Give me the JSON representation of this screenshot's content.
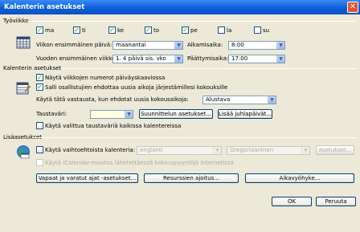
{
  "window": {
    "title": "Kalenterin asetukset",
    "close_glyph": "✕"
  },
  "workweek": {
    "section_label": "Työviikko",
    "days": [
      {
        "label": "ma",
        "checked": true
      },
      {
        "label": "ti",
        "checked": true
      },
      {
        "label": "ke",
        "checked": true
      },
      {
        "label": "to",
        "checked": true
      },
      {
        "label": "pe",
        "checked": true
      },
      {
        "label": "la",
        "checked": false
      },
      {
        "label": "su",
        "checked": false
      }
    ],
    "first_day_label": "Viikon ensimmäinen päivä:",
    "first_day_value": "maanantai",
    "first_week_label": "Vuoden ensimmäinen viikko:",
    "first_week_value": "1. 4 päivä sis. vko",
    "start_time_label": "Alkamisaika:",
    "start_time_value": "8:00",
    "end_time_label": "Päättymisaika:",
    "end_time_value": "17:00"
  },
  "calendar": {
    "section_label": "Kalenterin asetukset",
    "show_week_numbers": "Näytä viikkojen numerot päiväyskaaviossa",
    "allow_proposals": "Salli osallistujien ehdottaa uusia aikoja järjestämillesi kokouksille",
    "response_label": "Käytä tätä vastausta, kun ehdotat uusia kokousaikoja:",
    "response_value": "Alustava",
    "bg_color_label": "Taustaväri:",
    "scheduling_button": "Suunnittelun asetukset...",
    "holidays_button": "Lisää juhlapäivät...",
    "use_bg_all": "Käytä valittua taustaväriä kaikissa kalentereissa"
  },
  "advanced": {
    "section_label": "Lisäasetukset",
    "alt_calendar_label": "Käytä vaihtoehtoista kalenteria:",
    "alt_language": "englanti",
    "alt_type": "Gregoriaaninen",
    "alt_settings_button": "Asetukset...",
    "icalendar_label": "Käytä iCalendar-muotoa lähetettäessä kokouspyyntöjä Internetissä",
    "free_busy_button": "Vapaat ja varatut ajat -asetukset...",
    "resource_button": "Resurssien ajoitus...",
    "timezone_button": "Aikavyöhyke..."
  },
  "footer": {
    "ok": "OK",
    "cancel": "Peruuta"
  },
  "check_glyph": "✓",
  "arrow_glyph": "▼"
}
